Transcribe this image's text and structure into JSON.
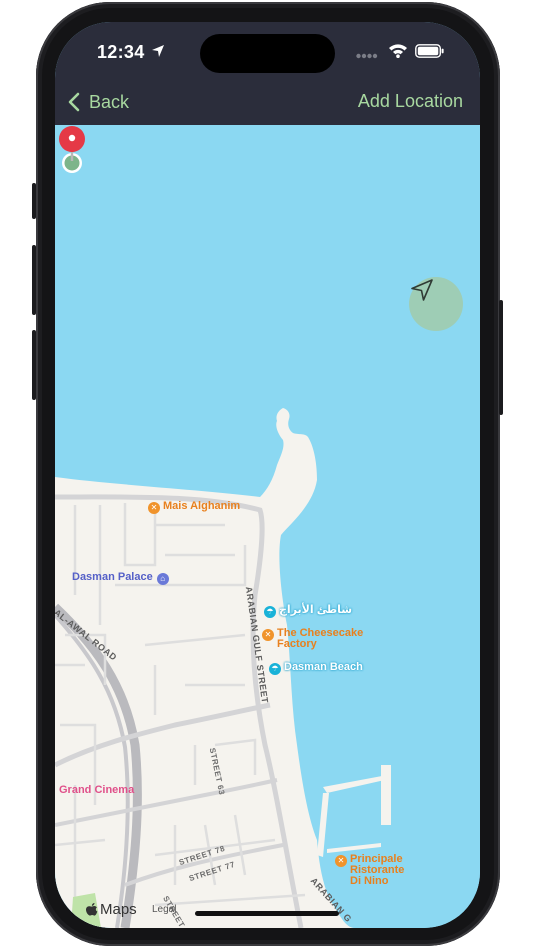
{
  "status_bar": {
    "time": "12:34",
    "icons": [
      "location-arrow-icon",
      "cellular-icon",
      "wifi-icon",
      "battery-icon"
    ]
  },
  "nav": {
    "back_label": "Back",
    "action_label": "Add Location"
  },
  "colors": {
    "nav_bg": "#2B2D3B",
    "nav_accent": "#A8D8A0",
    "water": "#8BD8F2",
    "land": "#F5F3EE",
    "pin": "#E53946",
    "locate_button": "#9ECDB5"
  },
  "map": {
    "pois": [
      {
        "label": "Mais Alghanim",
        "category": "food"
      },
      {
        "label": "Dasman Palace",
        "category": "palace"
      },
      {
        "label": "شاطئ الأبراج",
        "category": "beach"
      },
      {
        "label_line1": "The Cheesecake",
        "label_line2": "Factory",
        "category": "food"
      },
      {
        "label": "Dasman Beach",
        "category": "beach"
      },
      {
        "label": "Grand Cinema",
        "category": "cinema"
      },
      {
        "label_line1": "Principale",
        "label_line2": "Ristorante",
        "label_line3": "Di Nino",
        "category": "food"
      }
    ],
    "streets": {
      "arabian_gulf": "ARABIAN GULF STREET",
      "al_awal": "AL-AWAL ROAD",
      "street63": "STREET 63",
      "street76": "STREET 76",
      "street77": "STREET 77",
      "street78": "STREET 78",
      "arabian_lower": "ARABIAN G"
    },
    "attribution": "Maps",
    "legal": "Legal"
  }
}
